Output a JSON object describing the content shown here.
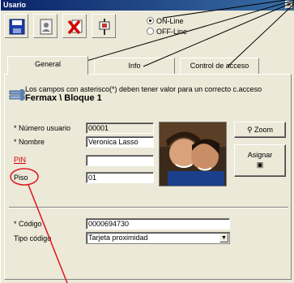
{
  "window": {
    "title": "Usario",
    "close_glyph": "×"
  },
  "toolbar": {
    "buttons": [
      {
        "icon": "save-icon"
      },
      {
        "icon": "user-card-icon"
      },
      {
        "icon": "delete-icon"
      },
      {
        "icon": "connection-icon"
      }
    ]
  },
  "mode": {
    "online_label": "ON-Line",
    "offline_label": "OFF-Line",
    "selected": "online"
  },
  "tabs": [
    {
      "label": "General",
      "active": true
    },
    {
      "label": "Info",
      "active": false
    },
    {
      "label": "Control de acceso",
      "active": false
    }
  ],
  "notice": {
    "text": "Los campos con asterisco(*) deben tener valor para un correcto c.acceso",
    "title": "Fermax \\ Bloque 1"
  },
  "form": {
    "numero_usuario": {
      "label": "* Número usuario",
      "value": "00001"
    },
    "nombre": {
      "label": "* Nombre",
      "value": "Veronica Lasso"
    },
    "pin": {
      "label": "PIN",
      "value": ""
    },
    "piso": {
      "label": "Piso",
      "value": "01"
    },
    "codigo": {
      "label": "* Código",
      "value": "0000694730"
    },
    "tipo_codigo": {
      "label": "Tipo código",
      "value": "Tarjeta proximidad"
    }
  },
  "buttons": {
    "zoom_label": "Zoom",
    "asignar_label": "Asignar"
  },
  "colors": {
    "title_bar": "#0a246a",
    "required_red": "#d40000",
    "callout_red": "#e0141e"
  }
}
